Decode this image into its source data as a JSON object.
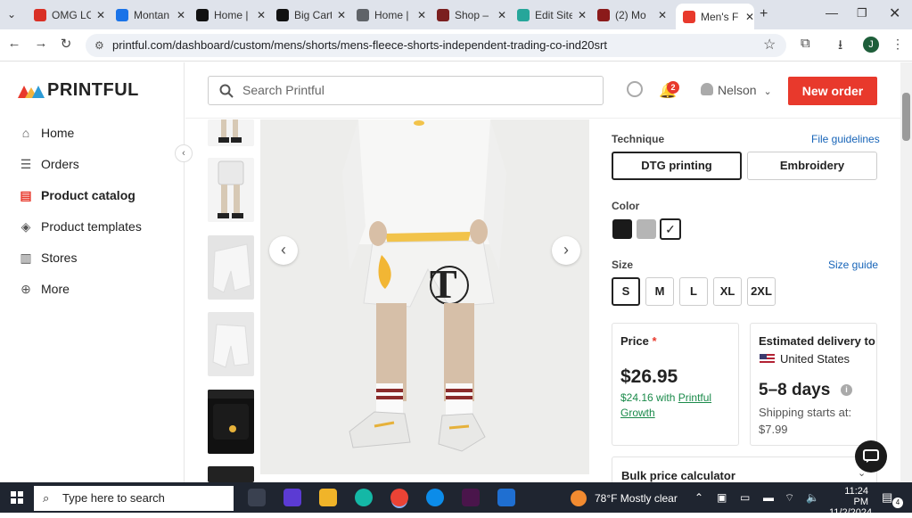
{
  "browser": {
    "tabs": [
      {
        "title": "OMG LC",
        "favicon": "gmail-icon",
        "color": "#d93025"
      },
      {
        "title": "Montan",
        "favicon": "drive-icon",
        "color": "#1a73e8"
      },
      {
        "title": "Home |",
        "favicon": "wix-icon",
        "color": "#111111"
      },
      {
        "title": "Big Cart",
        "favicon": "bigcartel-icon",
        "color": "#111111"
      },
      {
        "title": "Home |",
        "favicon": "globe-icon",
        "color": "#5f6368"
      },
      {
        "title": "Shop –",
        "favicon": "shop-icon",
        "color": "#7b1f1f"
      },
      {
        "title": "Edit Site",
        "favicon": "edit-icon",
        "color": "#26a69a"
      },
      {
        "title": "(2) Mo",
        "favicon": "mo-icon",
        "color": "#8b1a1a"
      },
      {
        "title": "Men's F",
        "favicon": "printful-icon",
        "color": "#e8392c"
      }
    ],
    "url": "printful.com/dashboard/custom/mens/shorts/mens-fleece-shorts-independent-trading-co-ind20srt",
    "profile_initial": "J"
  },
  "sidebar": {
    "logo": "PRINTFUL",
    "items": [
      {
        "label": "Home",
        "icon": "home-icon"
      },
      {
        "label": "Orders",
        "icon": "list-icon"
      },
      {
        "label": "Product catalog",
        "icon": "catalog-icon",
        "active": true
      },
      {
        "label": "Product templates",
        "icon": "template-icon"
      },
      {
        "label": "Stores",
        "icon": "store-icon"
      },
      {
        "label": "More",
        "icon": "plus-circle-icon"
      }
    ]
  },
  "header": {
    "search_placeholder": "Search Printful",
    "notification_count": "2",
    "user_name": "Nelson",
    "new_order_label": "New order"
  },
  "product": {
    "technique_label": "Technique",
    "file_guidelines": "File guidelines",
    "techniques": [
      "DTG printing",
      "Embroidery"
    ],
    "color_label": "Color",
    "colors": [
      "#1a1a1a",
      "#b5b5b5",
      "#ffffff"
    ],
    "size_label": "Size",
    "size_guide": "Size guide",
    "sizes": [
      "S",
      "M",
      "L",
      "XL",
      "2XL"
    ],
    "price_label": "Price",
    "price_required": "*",
    "price": "$26.95",
    "growth_price": "$24.16 with",
    "growth_link": "Printful Growth",
    "delivery_label": "Estimated delivery to",
    "delivery_country": "United States",
    "delivery_days": "5–8 days",
    "shipping_text": "Shipping starts at:",
    "shipping_price": "$7.99",
    "bulk_label": "Bulk price calculator"
  },
  "taskbar": {
    "search_placeholder": "Type here to search",
    "weather": "78°F  Mostly clear",
    "time": "11:24 PM",
    "date": "11/2/2024",
    "notifications": "4"
  }
}
